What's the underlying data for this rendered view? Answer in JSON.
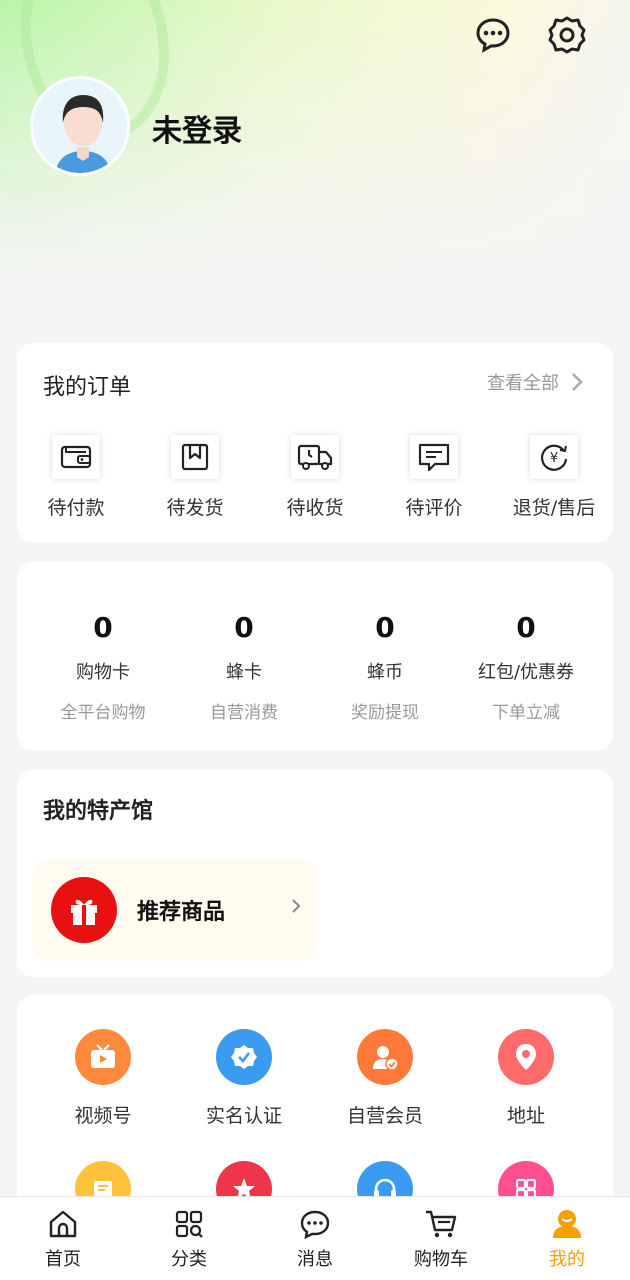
{
  "header": {
    "username": "未登录",
    "icons": [
      "message-icon",
      "settings-icon"
    ]
  },
  "orders": {
    "title": "我的订单",
    "view_all": "查看全部",
    "items": [
      {
        "label": "待付款",
        "icon": "wallet-icon"
      },
      {
        "label": "待发货",
        "icon": "package-icon"
      },
      {
        "label": "待收货",
        "icon": "truck-icon"
      },
      {
        "label": "待评价",
        "icon": "comment-icon"
      },
      {
        "label": "退货/售后",
        "icon": "refund-icon"
      }
    ]
  },
  "stats": [
    {
      "value": "0",
      "label": "购物卡",
      "sub": "全平台购物"
    },
    {
      "value": "0",
      "label": "蜂卡",
      "sub": "自营消费"
    },
    {
      "value": "0",
      "label": "蜂币",
      "sub": "奖励提现"
    },
    {
      "value": "0",
      "label": "红包/优惠券",
      "sub": "下单立减"
    }
  ],
  "specialty": {
    "title": "我的特产馆",
    "recommend": "推荐商品"
  },
  "services": [
    {
      "label": "视频号",
      "icon": "tv-icon",
      "color": "#ff8a3d"
    },
    {
      "label": "实名认证",
      "icon": "verified-icon",
      "color": "#3a9bf0"
    },
    {
      "label": "自营会员",
      "icon": "member-icon",
      "color": "#ff7a3a"
    },
    {
      "label": "地址",
      "icon": "location-icon",
      "color": "#ff6b6b"
    }
  ],
  "services_row2": [
    {
      "icon": "note-icon",
      "color": "#ffc23a"
    },
    {
      "icon": "star-icon",
      "color": "#f0344a"
    },
    {
      "icon": "headset-icon",
      "color": "#3a9bf0"
    },
    {
      "icon": "grid-icon",
      "color": "#ff4f8e"
    }
  ],
  "tabs": [
    {
      "label": "首页",
      "icon": "home-icon"
    },
    {
      "label": "分类",
      "icon": "category-icon"
    },
    {
      "label": "消息",
      "icon": "message-icon"
    },
    {
      "label": "购物车",
      "icon": "cart-icon"
    },
    {
      "label": "我的",
      "icon": "user-icon",
      "active": true
    }
  ],
  "colors": {
    "accent": "#f5a000",
    "gift_red": "#e81010"
  }
}
